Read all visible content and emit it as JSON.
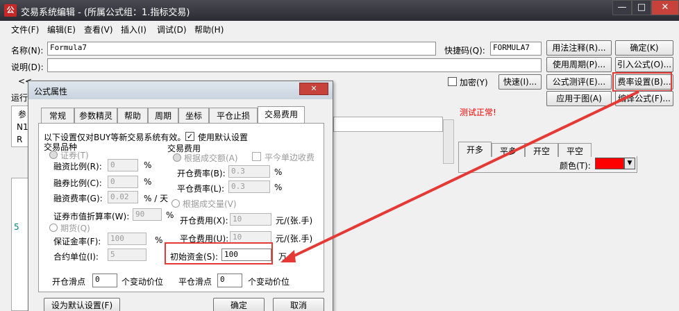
{
  "window": {
    "title": "交易系统编辑 - (所属公式组：1.指标交易)",
    "app_icon": "公",
    "minimize": "—",
    "maximize": "□",
    "close": "✕"
  },
  "menu": [
    "文件(F)",
    "编辑(E)",
    "查看(V)",
    "插入(I)",
    "调试(D)",
    "帮助(H)"
  ],
  "form": {
    "name_label": "名称(N):",
    "name_value": "Formula7",
    "shortcut_label": "快捷码(Q):",
    "shortcut_value": "FORMULA7",
    "desc_label": "说明(D):",
    "desc_value": "",
    "encrypt_label": "加密(Y)",
    "quick_button": "快速(I)...",
    "run_label": "运行",
    "collapse_glyph": "<<",
    "status_text": "测试正常!",
    "params_header": "参",
    "params_rows": [
      "N1",
      "R"
    ],
    "editor_line_number": "5"
  },
  "right_buttons": {
    "usage_note": "用法注释(R)...",
    "ok": "确定(K)",
    "usage_period": "使用周期(P)...",
    "import_formula": "引入公式(O)...",
    "formula_test": "公式测评(E)...",
    "fee_settings": "费率设置(B)...",
    "apply_chart": "应用于图(A)",
    "compile": "编译公式(F)..."
  },
  "signal_tabs": [
    "开多",
    "平多",
    "开空",
    "平空"
  ],
  "color_label": "颜色(T):",
  "colors": {
    "signal_color": "#ff0000",
    "highlight": "#e53935",
    "status": "#ff0000"
  },
  "dialog": {
    "title": "公式属性",
    "close": "✕",
    "tabs": [
      "常规",
      "参数精灵",
      "帮助",
      "周期",
      "坐标",
      "平仓止损",
      "交易费用"
    ],
    "active_tab": "交易费用",
    "intro": "以下设置仅对BUY等新交易系统有效。",
    "use_default": "使用默认设置",
    "variety_label": "交易品种",
    "security_label": "证券(T)",
    "margin_ratio_label": "融资比例(R):",
    "margin_ratio_value": "0",
    "percent": "%",
    "short_ratio_label": "融券比例(C):",
    "short_ratio_value": "0",
    "margin_rate_label": "融资费率(G):",
    "margin_rate_value": "0.02",
    "per_day": "% / 天",
    "market_rate_label": "证券市值折算率(W):",
    "market_rate_value": "90",
    "futures_label": "期货(Q)",
    "deposit_label": "保证金率(F):",
    "deposit_value": "100",
    "contract_label": "合约单位(I):",
    "contract_value": "5",
    "fee_label": "交易费用",
    "by_amount_label": "根据成交额(A)",
    "close_today_half": "平今单边收费",
    "open_rate_label": "开仓费率(B):",
    "open_rate_value": "0.3",
    "close_rate_label": "平仓费率(L):",
    "close_rate_value": "0.3",
    "by_volume_label": "根据成交量(V)",
    "open_fee_label": "开仓费用(X):",
    "open_fee_value": "10",
    "per_lot": "元/(张.手)",
    "close_fee_label": "平仓费用(U):",
    "close_fee_value": "10",
    "init_capital_label": "初始资金(S):",
    "init_capital_value": "100",
    "wan": "万",
    "open_slip_label": "开仓滑点",
    "open_slip_value": "0",
    "slip_unit": "个变动价位",
    "close_slip_label": "平仓滑点",
    "close_slip_value": "0",
    "set_default_button": "设为默认设置(F)",
    "ok_button": "确定",
    "cancel_button": "取消"
  }
}
